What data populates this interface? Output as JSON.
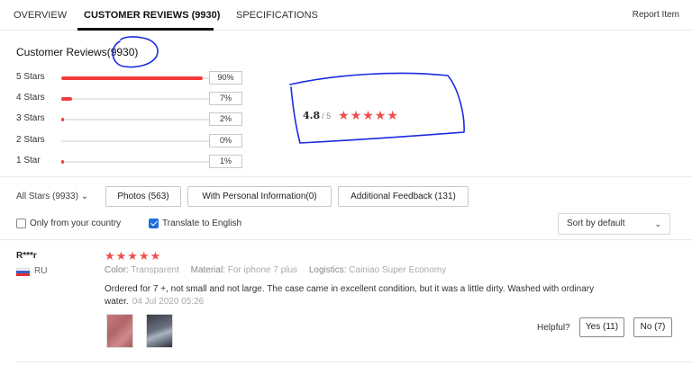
{
  "tabs": [
    {
      "label": "OVERVIEW"
    },
    {
      "label": "CUSTOMER REVIEWS (9930)"
    },
    {
      "label": "SPECIFICATIONS"
    }
  ],
  "report_label": "Report Item",
  "reviews": {
    "heading": "Customer Reviews",
    "count": "(9930)",
    "distribution": [
      {
        "label": "5 Stars",
        "pct": "90%",
        "value": 0.9
      },
      {
        "label": "4 Stars",
        "pct": "7%",
        "value": 0.07
      },
      {
        "label": "3 Stars",
        "pct": "2%",
        "value": 0.02
      },
      {
        "label": "2 Stars",
        "pct": "0%",
        "value": 0.0
      },
      {
        "label": "1 Star",
        "pct": "1%",
        "value": 0.01
      }
    ],
    "average": "4.8",
    "average_max": "/ 5",
    "average_stars": "★★★★★",
    "star_color": "#f04d4d",
    "annotation_color": "#1a2be0"
  },
  "filters": {
    "all_stars": "All Stars (9933)",
    "buttons": [
      "Photos (563)",
      "With Personal Information(0)",
      "Additional Feedback (131)"
    ],
    "only_country": {
      "label": "Only from your country",
      "checked": false
    },
    "translate": {
      "label": "Translate to English",
      "checked": true
    },
    "sort": "Sort by default"
  },
  "review": {
    "user": "R***r",
    "country": "RU",
    "stars": "★★★★★",
    "color_key": "Color:",
    "color_val": "Transparent",
    "material_key": "Material:",
    "material_val": "For iphone 7 plus",
    "logistics_key": "Logistics:",
    "logistics_val": "Cainiao Super Economy",
    "text": "Ordered for 7 +, not small and not large. The case came in excellent condition, but it was a little dirty. Washed with ordinary water.",
    "date": "04 Jul 2020 05:26",
    "helpful_label": "Helpful?",
    "yes": "Yes (11)",
    "no": "No (7)"
  }
}
